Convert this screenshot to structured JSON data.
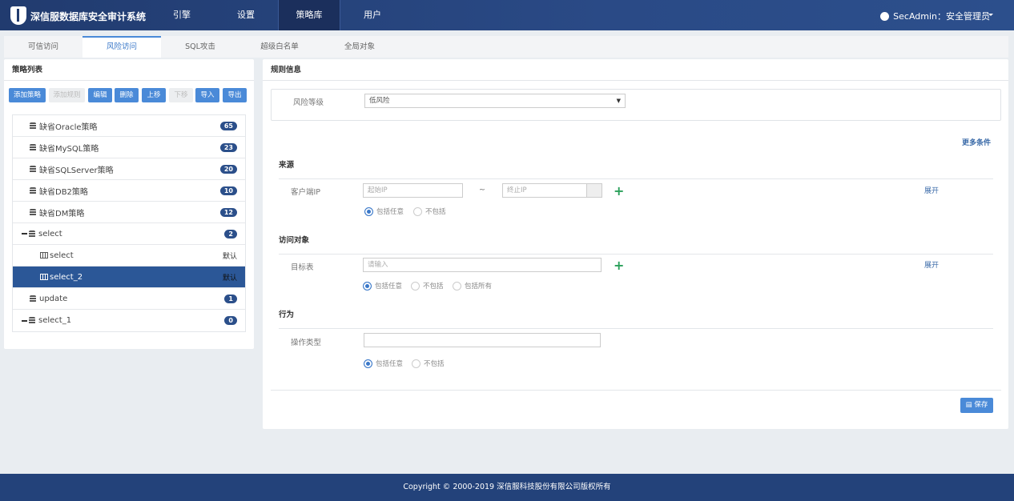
{
  "header": {
    "title": "深信服数据库安全审计系统",
    "nav": [
      "引擎",
      "设置",
      "策略库",
      "用户"
    ],
    "active_nav": "策略库",
    "user": "SecAdmin：安全管理员"
  },
  "tabs": [
    "可信访问",
    "风险访问",
    "SQL攻击",
    "超级白名单",
    "全局对象"
  ],
  "left": {
    "title": "策略列表",
    "buttons": [
      "添加策略",
      "添加规则",
      "编辑",
      "删除",
      "上移",
      "下移",
      "导入",
      "导出"
    ],
    "items": [
      {
        "label": "缺省Oracle策略",
        "count": "65"
      },
      {
        "label": "缺省MySQL策略",
        "count": "23"
      },
      {
        "label": "缺省SQLServer策略",
        "count": "20"
      },
      {
        "label": "缺省DB2策略",
        "count": "10"
      },
      {
        "label": "缺省DM策略",
        "count": "12"
      },
      {
        "label": "select",
        "count": "2"
      },
      {
        "label": "select",
        "tag": "默认"
      },
      {
        "label": "select_2",
        "tag": "默认"
      },
      {
        "label": "update",
        "count": "1"
      },
      {
        "label": "select_1",
        "count": "0"
      }
    ]
  },
  "right": {
    "title": "规则信息",
    "risk_label": "风险等级",
    "risk_value": "低风险",
    "more": "更多条件",
    "source": {
      "title": "来源",
      "label": "客户端IP",
      "start_ph": "起始IP",
      "sep": "~",
      "end_ph": "终止IP",
      "expand": "展开",
      "opt1": "包括任意",
      "opt2": "不包括"
    },
    "object": {
      "title": "访问对象",
      "label": "目标表",
      "ph": "请输入",
      "expand": "展开",
      "opt1": "包括任意",
      "opt2": "不包括",
      "opt3": "包括所有"
    },
    "behavior": {
      "title": "行为",
      "label": "操作类型",
      "value": "",
      "opt1": "包括任意",
      "opt2": "不包括"
    },
    "save": "保存"
  },
  "footer": "Copyright © 2000-2019 深信服科技股份有限公司版权所有"
}
